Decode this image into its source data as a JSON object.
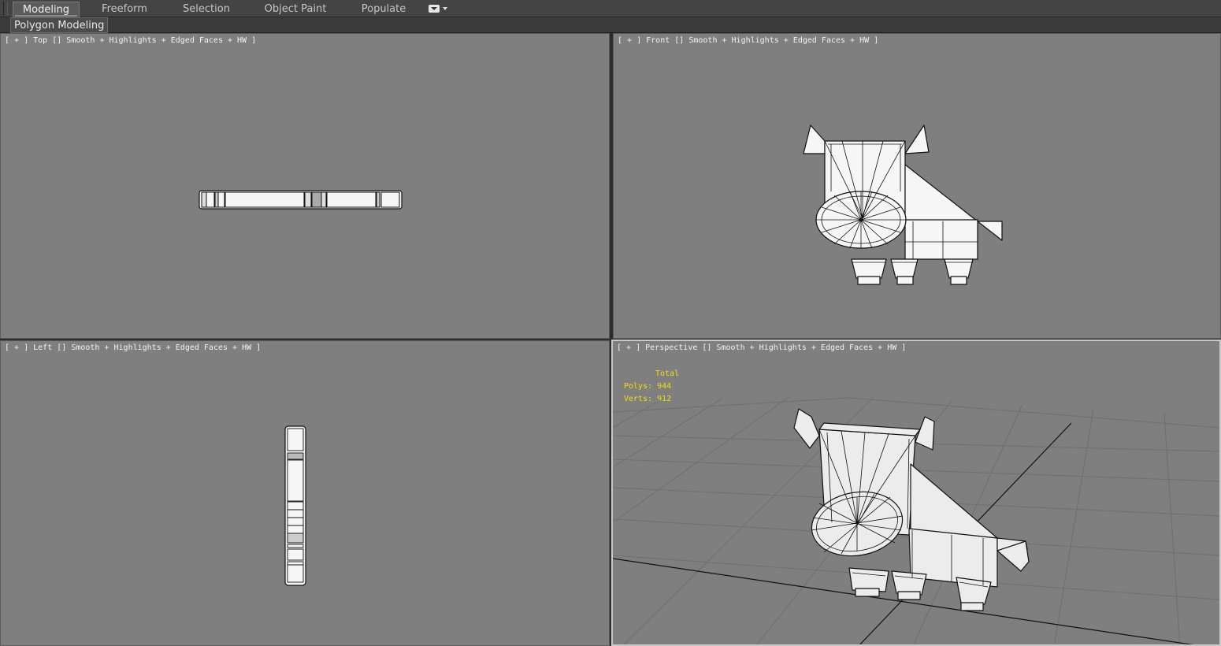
{
  "ribbon": {
    "tabs": [
      "Modeling",
      "Freeform",
      "Selection",
      "Object Paint",
      "Populate"
    ],
    "active_tab": "Modeling",
    "panel_label": "Polygon Modeling"
  },
  "viewports": {
    "top": {
      "plus": "[ + ]",
      "name": "Top",
      "shading": "Smooth + Highlights + Edged Faces + HW ]"
    },
    "front": {
      "plus": "[ + ]",
      "name": "Front",
      "shading": "Smooth + Highlights + Edged Faces + HW ]"
    },
    "left": {
      "plus": "[ + ]",
      "name": "Left",
      "shading": "Smooth + Highlights + Edged Faces + HW ]"
    },
    "perspective": {
      "plus": "[ + ]",
      "name": "Perspective",
      "shading": "Smooth + Highlights + Edged Faces + HW ]"
    }
  },
  "stats": {
    "total_label": "Total",
    "polys": "Polys: 944",
    "verts": "Verts: 912"
  },
  "colors": {
    "viewport_bg": "#7f7f7f",
    "stats_text": "#f0e000",
    "ui_dark": "#444444"
  }
}
